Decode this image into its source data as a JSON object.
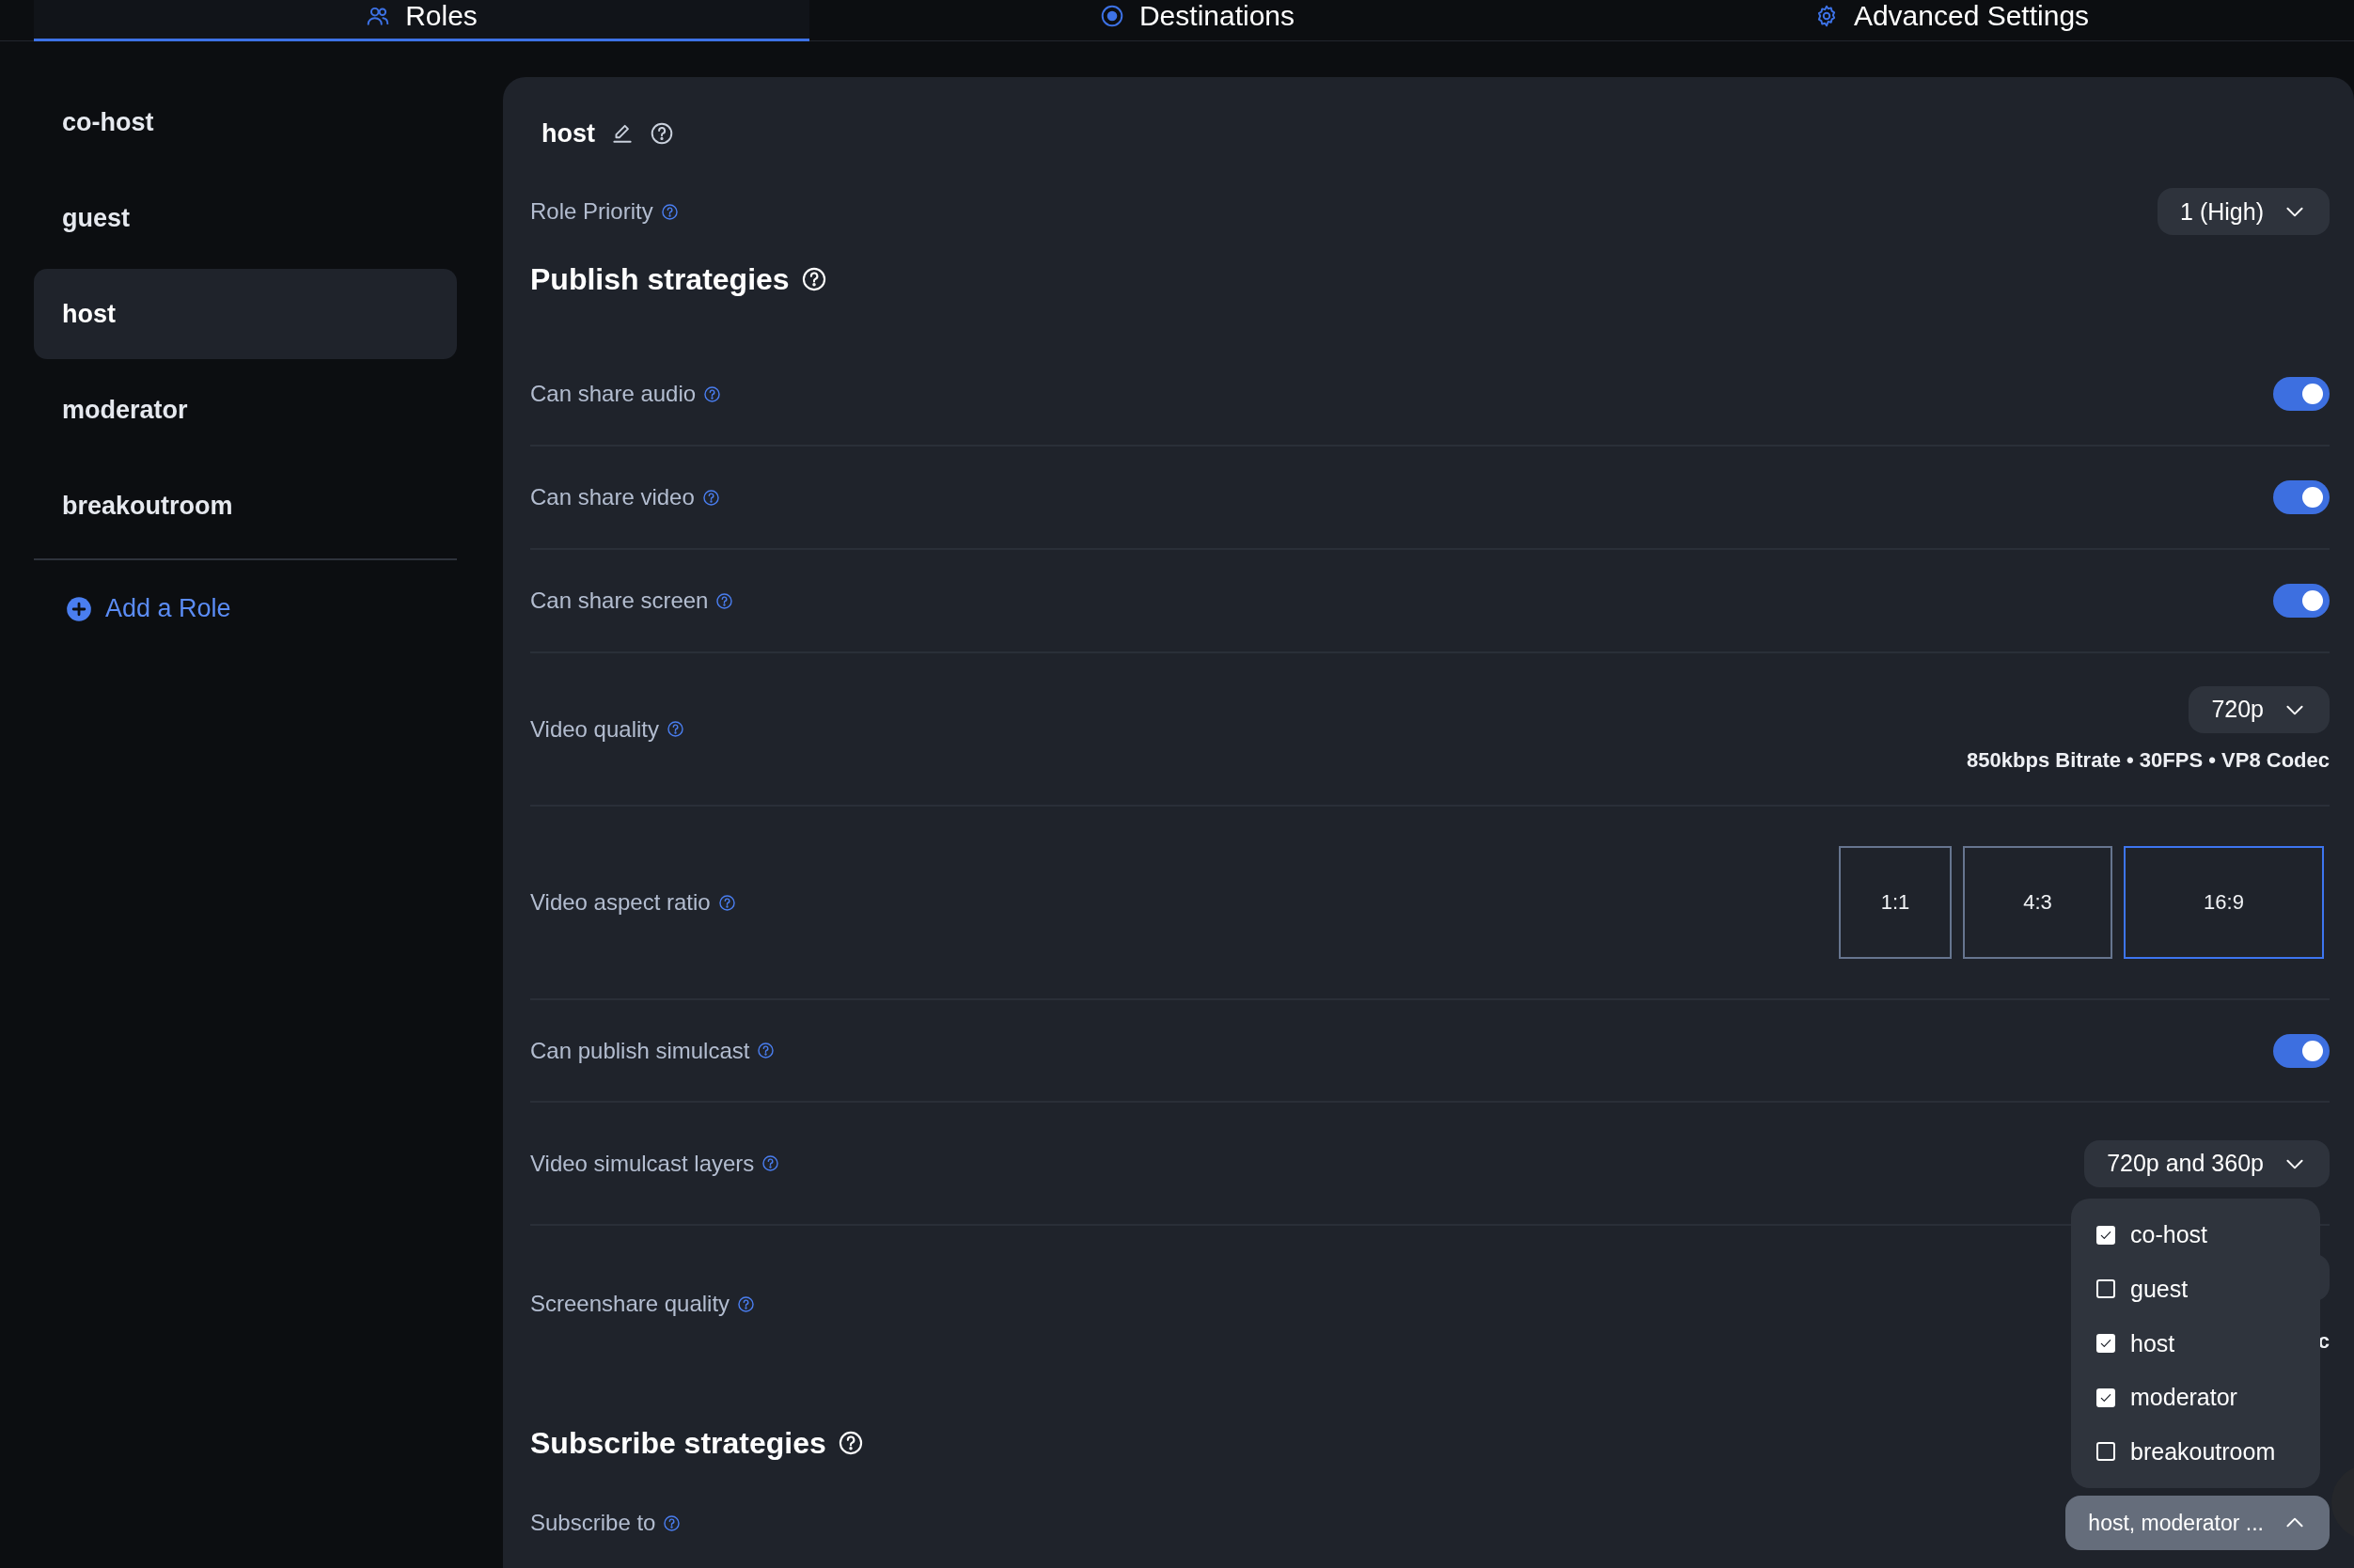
{
  "tabs": [
    {
      "label": "Roles",
      "selected": true
    },
    {
      "label": "Destinations",
      "selected": false
    },
    {
      "label": "Advanced Settings",
      "selected": false
    }
  ],
  "sidebar": {
    "roles": [
      {
        "label": "co-host",
        "selected": false
      },
      {
        "label": "guest",
        "selected": false
      },
      {
        "label": "host",
        "selected": true
      },
      {
        "label": "moderator",
        "selected": false
      },
      {
        "label": "breakoutroom",
        "selected": false
      }
    ],
    "add_button": "Add a Role"
  },
  "role": {
    "name": "host"
  },
  "role_priority": {
    "label": "Role Priority",
    "value": "1 (High)"
  },
  "publish": {
    "title": "Publish strategies",
    "settings": [
      {
        "kind": "toggle",
        "label": "Can share audio",
        "on": true
      },
      {
        "kind": "toggle",
        "label": "Can share video",
        "on": true
      },
      {
        "kind": "toggle",
        "label": "Can share screen",
        "on": true
      },
      {
        "kind": "select",
        "label": "Video quality",
        "value": "720p",
        "caption": "850kbps Bitrate • 30FPS • VP8 Codec"
      },
      {
        "kind": "ratio",
        "label": "Video aspect ratio",
        "options": [
          {
            "label": "1:1",
            "selected": false
          },
          {
            "label": "4:3",
            "selected": false
          },
          {
            "label": "16:9",
            "selected": true
          }
        ]
      },
      {
        "kind": "toggle",
        "label": "Can publish simulcast",
        "on": true
      },
      {
        "kind": "select",
        "label": "Video simulcast layers",
        "value": "720p and 360p"
      },
      {
        "kind": "select",
        "label": "Screenshare quality",
        "caption": "c"
      }
    ]
  },
  "subscribe": {
    "title": "Subscribe strategies",
    "label": "Subscribe to",
    "value": "host, moderator ...",
    "expanded": true,
    "options": [
      {
        "label": "co-host",
        "checked": true
      },
      {
        "label": "guest",
        "checked": false
      },
      {
        "label": "host",
        "checked": true
      },
      {
        "label": "moderator",
        "checked": true
      },
      {
        "label": "breakoutroom",
        "checked": false
      }
    ]
  }
}
